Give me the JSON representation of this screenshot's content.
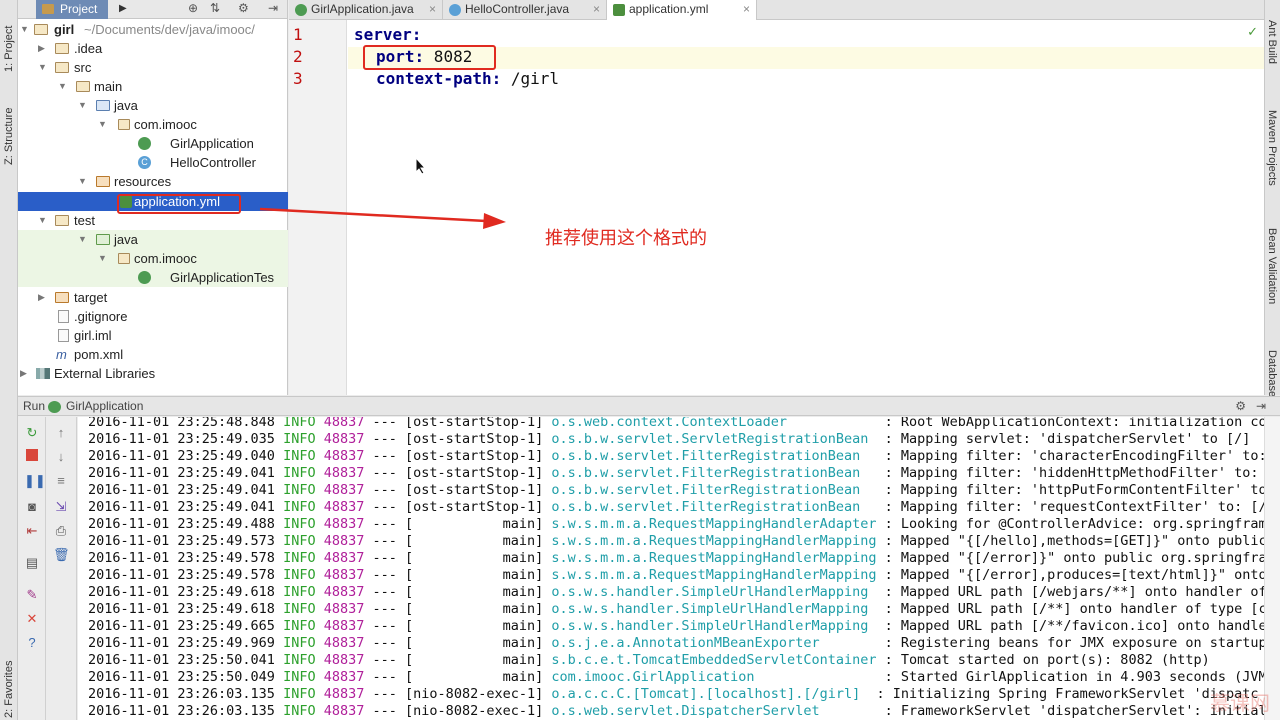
{
  "left_strip": {
    "project_tab": "1: Project",
    "structure_tab": "Z: Structure",
    "favorites_tab": "2: Favorites"
  },
  "right_strip": {
    "ant_tab": "Ant Build",
    "maven_tab": "Maven Projects",
    "bean_tab": "Bean Validation",
    "db_tab": "Database"
  },
  "project_panel": {
    "tab_label": "Project",
    "tree": [
      {
        "label": "girl",
        "suffix": "~/Documents/dev/java/imooc/"
      },
      {
        "label": ".idea"
      },
      {
        "label": "src"
      },
      {
        "label": "main"
      },
      {
        "label": "java"
      },
      {
        "label": "com.imooc"
      },
      {
        "label": "GirlApplication"
      },
      {
        "label": "HelloController"
      },
      {
        "label": "resources"
      },
      {
        "label": "application.yml"
      },
      {
        "label": "test"
      },
      {
        "label": "java"
      },
      {
        "label": "com.imooc"
      },
      {
        "label": "GirlApplicationTes"
      },
      {
        "label": "target"
      },
      {
        "label": ".gitignore"
      },
      {
        "label": "girl.iml"
      },
      {
        "label": "pom.xml"
      },
      {
        "label": "External Libraries"
      }
    ]
  },
  "editor": {
    "tabs": [
      {
        "label": "GirlApplication.java"
      },
      {
        "label": "HelloController.java"
      },
      {
        "label": "application.yml"
      }
    ],
    "lines": [
      {
        "no": "1",
        "key": "server:",
        "value": ""
      },
      {
        "no": "2",
        "key": "port:",
        "value": " 8082"
      },
      {
        "no": "3",
        "key": "context-path:",
        "value": " /girl"
      }
    ]
  },
  "annotation": {
    "text": "推荐使用这个格式的"
  },
  "run_panel": {
    "label": "Run",
    "app_name": "GirlApplication",
    "logs": [
      {
        "ts": "2016-11-01 23:25:48.848",
        "lvl": "INFO",
        "pid": "48837",
        "sep": "---",
        "thread": "[ost-startStop-1]",
        "src": "o.s.web.context.ContextLoader           ",
        "msg": ": Root WebApplicationContext: initialization co"
      },
      {
        "ts": "2016-11-01 23:25:49.035",
        "lvl": "INFO",
        "pid": "48837",
        "sep": "---",
        "thread": "[ost-startStop-1]",
        "src": "o.s.b.w.servlet.ServletRegistrationBean ",
        "msg": ": Mapping servlet: 'dispatcherServlet' to [/]"
      },
      {
        "ts": "2016-11-01 23:25:49.040",
        "lvl": "INFO",
        "pid": "48837",
        "sep": "---",
        "thread": "[ost-startStop-1]",
        "src": "o.s.b.w.servlet.FilterRegistrationBean  ",
        "msg": ": Mapping filter: 'characterEncodingFilter' to:"
      },
      {
        "ts": "2016-11-01 23:25:49.041",
        "lvl": "INFO",
        "pid": "48837",
        "sep": "---",
        "thread": "[ost-startStop-1]",
        "src": "o.s.b.w.servlet.FilterRegistrationBean  ",
        "msg": ": Mapping filter: 'hiddenHttpMethodFilter' to:"
      },
      {
        "ts": "2016-11-01 23:25:49.041",
        "lvl": "INFO",
        "pid": "48837",
        "sep": "---",
        "thread": "[ost-startStop-1]",
        "src": "o.s.b.w.servlet.FilterRegistrationBean  ",
        "msg": ": Mapping filter: 'httpPutFormContentFilter' to"
      },
      {
        "ts": "2016-11-01 23:25:49.041",
        "lvl": "INFO",
        "pid": "48837",
        "sep": "---",
        "thread": "[ost-startStop-1]",
        "src": "o.s.b.w.servlet.FilterRegistrationBean  ",
        "msg": ": Mapping filter: 'requestContextFilter' to: [/"
      },
      {
        "ts": "2016-11-01 23:25:49.488",
        "lvl": "INFO",
        "pid": "48837",
        "sep": "---",
        "thread": "[           main]",
        "src": "s.w.s.m.m.a.RequestMappingHandlerAdapter",
        "msg": ": Looking for @ControllerAdvice: org.springfram"
      },
      {
        "ts": "2016-11-01 23:25:49.573",
        "lvl": "INFO",
        "pid": "48837",
        "sep": "---",
        "thread": "[           main]",
        "src": "s.w.s.m.m.a.RequestMappingHandlerMapping",
        "msg": ": Mapped \"{[/hello],methods=[GET]}\" onto public"
      },
      {
        "ts": "2016-11-01 23:25:49.578",
        "lvl": "INFO",
        "pid": "48837",
        "sep": "---",
        "thread": "[           main]",
        "src": "s.w.s.m.m.a.RequestMappingHandlerMapping",
        "msg": ": Mapped \"{[/error]}\" onto public org.springfra"
      },
      {
        "ts": "2016-11-01 23:25:49.578",
        "lvl": "INFO",
        "pid": "48837",
        "sep": "---",
        "thread": "[           main]",
        "src": "s.w.s.m.m.a.RequestMappingHandlerMapping",
        "msg": ": Mapped \"{[/error],produces=[text/html]}\" onto"
      },
      {
        "ts": "2016-11-01 23:25:49.618",
        "lvl": "INFO",
        "pid": "48837",
        "sep": "---",
        "thread": "[           main]",
        "src": "o.s.w.s.handler.SimpleUrlHandlerMapping ",
        "msg": ": Mapped URL path [/webjars/**] onto handler of"
      },
      {
        "ts": "2016-11-01 23:25:49.618",
        "lvl": "INFO",
        "pid": "48837",
        "sep": "---",
        "thread": "[           main]",
        "src": "o.s.w.s.handler.SimpleUrlHandlerMapping ",
        "msg": ": Mapped URL path [/**] onto handler of type [c"
      },
      {
        "ts": "2016-11-01 23:25:49.665",
        "lvl": "INFO",
        "pid": "48837",
        "sep": "---",
        "thread": "[           main]",
        "src": "o.s.w.s.handler.SimpleUrlHandlerMapping ",
        "msg": ": Mapped URL path [/**/favicon.ico] onto handle"
      },
      {
        "ts": "2016-11-01 23:25:49.969",
        "lvl": "INFO",
        "pid": "48837",
        "sep": "---",
        "thread": "[           main]",
        "src": "o.s.j.e.a.AnnotationMBeanExporter       ",
        "msg": ": Registering beans for JMX exposure on startup"
      },
      {
        "ts": "2016-11-01 23:25:50.041",
        "lvl": "INFO",
        "pid": "48837",
        "sep": "---",
        "thread": "[           main]",
        "src": "s.b.c.e.t.TomcatEmbeddedServletContainer",
        "msg": ": Tomcat started on port(s): 8082 (http)"
      },
      {
        "ts": "2016-11-01 23:25:50.049",
        "lvl": "INFO",
        "pid": "48837",
        "sep": "---",
        "thread": "[           main]",
        "src": "com.imooc.GirlApplication               ",
        "msg": ": Started GirlApplication in 4.903 seconds (JVM"
      },
      {
        "ts": "2016-11-01 23:26:03.135",
        "lvl": "INFO",
        "pid": "48837",
        "sep": "---",
        "thread": "[nio-8082-exec-1]",
        "src": "o.a.c.c.C.[Tomcat].[localhost].[/girl] ",
        "msg": ": Initializing Spring FrameworkServlet 'dispatc"
      },
      {
        "ts": "2016-11-01 23:26:03.135",
        "lvl": "INFO",
        "pid": "48837",
        "sep": "---",
        "thread": "[nio-8082-exec-1]",
        "src": "o.s.web.servlet.DispatcherServlet       ",
        "msg": ": FrameworkServlet 'dispatcherServlet': initial"
      }
    ]
  },
  "watermark": "慕课网"
}
